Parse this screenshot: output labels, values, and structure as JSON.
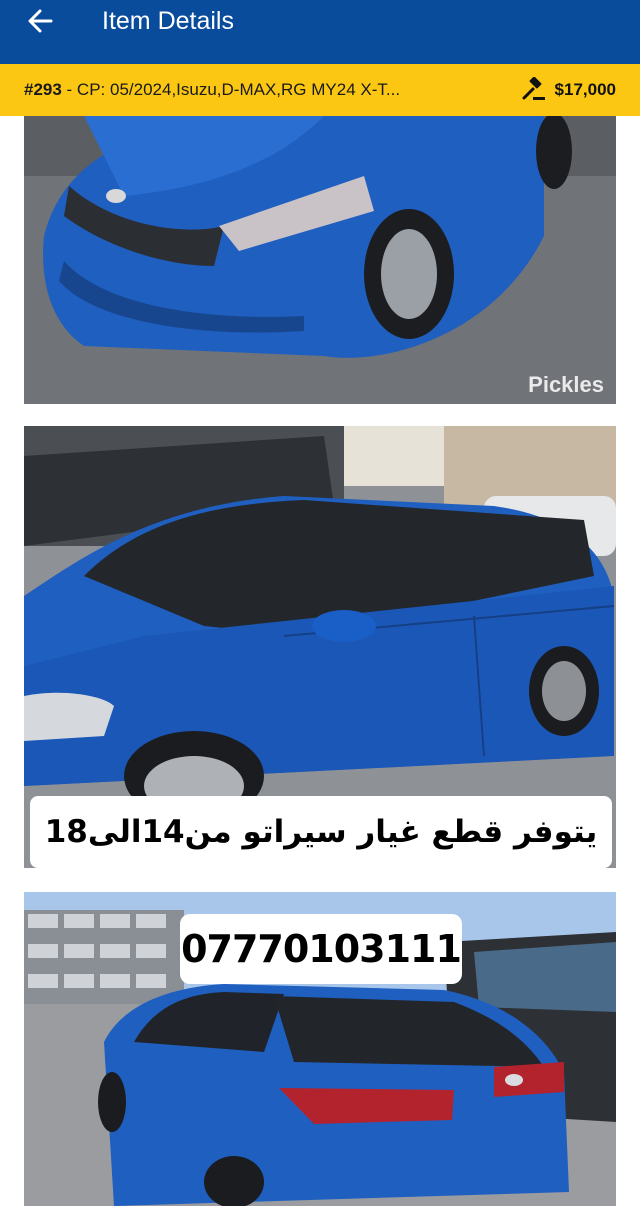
{
  "header": {
    "title": "Item Details",
    "back_icon": "arrow-left-icon"
  },
  "listing": {
    "lot_number": "#293",
    "lot_description": " - CP: 05/2024,Isuzu,D-MAX,RG MY24 X-T...",
    "price": "$17,000",
    "auction_icon": "gavel-icon"
  },
  "photos": [
    {
      "watermark": "Pickles"
    },
    {
      "overlay_text": "يتوفر قطع غيار سيراتو من14الى18"
    },
    {
      "overlay_text": "07770103111"
    }
  ],
  "colors": {
    "appbar": "#0a4c9c",
    "infobar": "#fbc713",
    "car_blue": "#1f5fc0"
  }
}
